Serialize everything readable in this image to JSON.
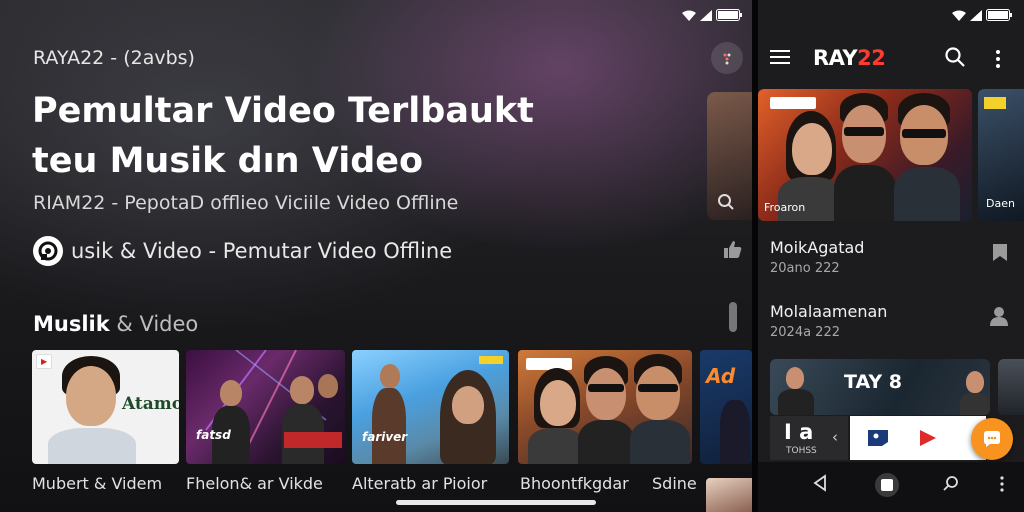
{
  "colors": {
    "accent_red": "#ff3b30",
    "fab_orange": "#f7931e",
    "panel_bg": "#1c1c1e"
  },
  "left": {
    "app_subtitle": "RAYA22 - (2avbs)",
    "headline_line1": "Pemultar Video Terlbaukt",
    "headline_line2": "teu Musik dın Video",
    "description": "RIAM22 - PepotaD offlieo Viciile Video Offline",
    "tagline": "usik & Video - Pemutar Video Offline",
    "section_title_bold": "Muslik",
    "section_title_rest": " & Video",
    "cards": [
      {
        "caption": "Mubert & Videm",
        "brand_text": "Atamoo"
      },
      {
        "caption": "Fhelon& ar Vikde",
        "overlay_text": "fatsd"
      },
      {
        "caption": "Alteratb ar Pioior",
        "overlay_text": "fariver"
      },
      {
        "caption": "Bhoontfkgdar",
        "overlay_text": ""
      },
      {
        "caption": "Sdine",
        "overlay_text": "Ad"
      }
    ]
  },
  "right": {
    "brand_part1": "RAY",
    "brand_part2": "22",
    "hero_caption": "Froaron",
    "hero_peek_caption": "Daen",
    "list": [
      {
        "title": "MoikAgatad",
        "date": "20ano 222"
      },
      {
        "title": "Molalaamenan",
        "date": "2024a 222"
      }
    ],
    "banner_title": "TAY 8",
    "player_big": "I a",
    "player_small": "TOHSS"
  },
  "icons": {
    "menu": "menu-icon",
    "search": "search-icon",
    "more": "more-vert-icon",
    "cast": "cast-icon",
    "bookmark": "bookmark-icon",
    "download": "download-icon",
    "play": "play-icon",
    "back": "back-icon",
    "home": "home-icon",
    "recent": "recent-apps-icon"
  }
}
